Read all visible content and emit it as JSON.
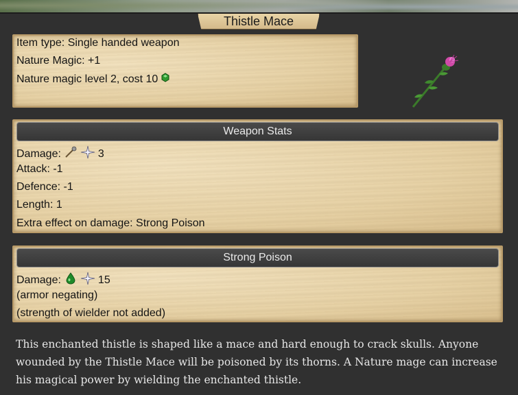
{
  "window": {
    "title": "Thistle Mace"
  },
  "info": {
    "item_type": "Item type: Single handed weapon",
    "nature_magic": "Nature Magic: +1",
    "magic_level": "Nature magic level 2, cost 10",
    "gem_icon": "green-gem-icon"
  },
  "weapon_stats": {
    "header": "Weapon Stats",
    "damage_label": "Damage:",
    "damage_value": "3",
    "damage_type_icon": "mace-icon",
    "damage_bonus_icon": "sparkle-icon",
    "attack": "Attack: -1",
    "defence": "Defence: -1",
    "length": "Length: 1",
    "extra_effect": "Extra effect on damage: Strong Poison"
  },
  "strong_poison": {
    "header": "Strong Poison",
    "damage_label": "Damage:",
    "damage_value": "15",
    "damage_type_icon": "poison-drop-icon",
    "damage_bonus_icon": "sparkle-icon",
    "note1": "(armor negating)",
    "note2": "(strength of wielder not added)"
  },
  "description": "This enchanted thistle is shaped like a mace and hard enough to crack skulls. Anyone wounded by the Thistle Mace will be poisoned by its thorns. A Nature mage can increase his magical power by wielding the enchanted thistle.",
  "colors": {
    "parchment": "#e7d2a6",
    "panel": "#303030",
    "header_bar": "#3f3f3f",
    "nature_green": "#2f8a2f",
    "thistle_pink": "#d04aa8"
  }
}
